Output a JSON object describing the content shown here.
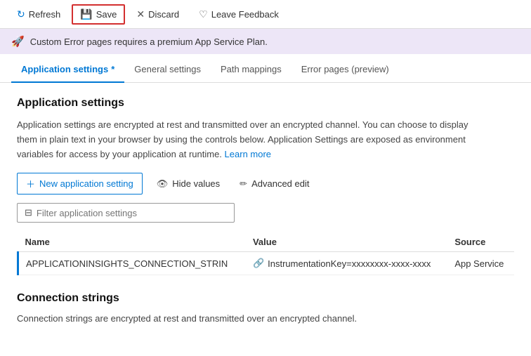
{
  "toolbar": {
    "refresh_label": "Refresh",
    "save_label": "Save",
    "discard_label": "Discard",
    "feedback_label": "Leave Feedback"
  },
  "banner": {
    "text": "Custom Error pages requires a premium App Service Plan."
  },
  "tabs": [
    {
      "id": "app-settings",
      "label": "Application settings",
      "active": true,
      "asterisk": true
    },
    {
      "id": "general-settings",
      "label": "General settings",
      "active": false
    },
    {
      "id": "path-mappings",
      "label": "Path mappings",
      "active": false
    },
    {
      "id": "error-pages",
      "label": "Error pages (preview)",
      "active": false
    }
  ],
  "main": {
    "section_title": "Application settings",
    "description_line1": "Application settings are encrypted at rest and transmitted over an encrypted channel. You can choose to display",
    "description_line2": "them in plain text in your browser by using the controls below. Application Settings are exposed as environment",
    "description_line3": "variables for access by your application at runtime.",
    "learn_more_label": "Learn more",
    "actions": {
      "new_setting_label": "New application setting",
      "hide_values_label": "Hide values",
      "advanced_edit_label": "Advanced edit"
    },
    "filter_placeholder": "Filter application settings",
    "table": {
      "columns": [
        "Name",
        "Value",
        "Source"
      ],
      "rows": [
        {
          "name": "APPLICATIONINSIGHTS_CONNECTION_STRIN",
          "value": "InstrumentationKey=xxxxxxxx-xxxx-xxxx",
          "source": "App Service"
        }
      ]
    }
  },
  "connection_strings": {
    "title": "Connection strings",
    "description": "Connection strings are encrypted at rest and transmitted over an encrypted channel."
  }
}
